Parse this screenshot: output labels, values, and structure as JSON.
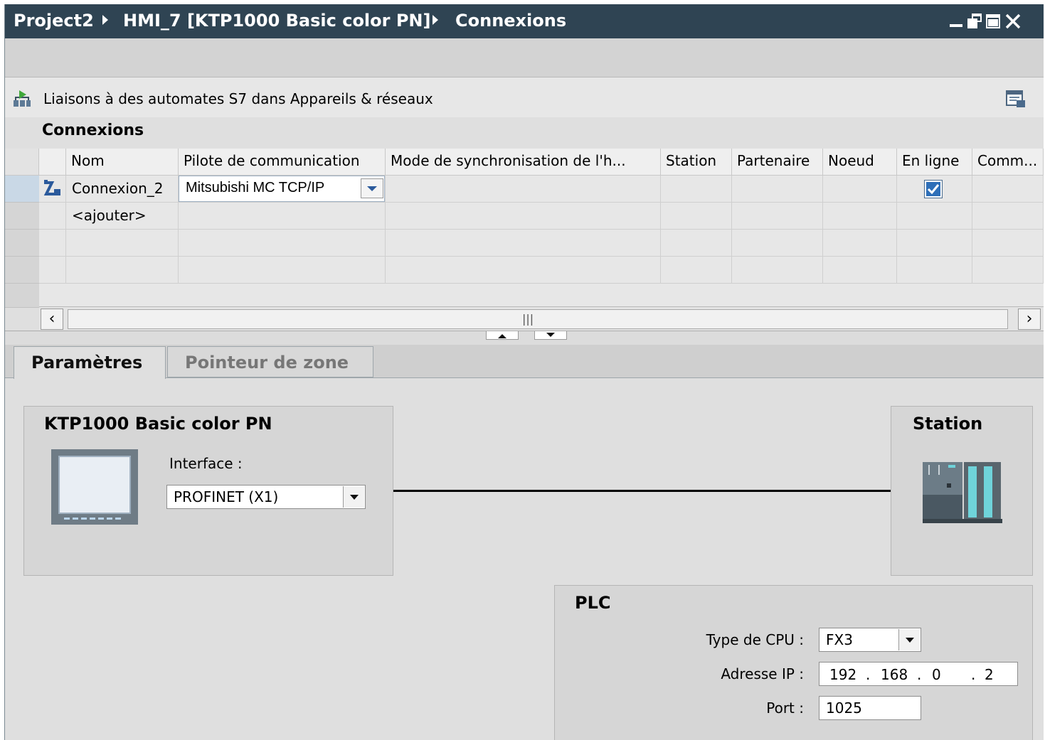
{
  "window": {
    "breadcrumb": [
      "Project2",
      "HMI_7 [KTP1000 Basic color PN]",
      "Connexions"
    ],
    "controls": [
      "minimize-icon",
      "restore-icon",
      "maximize-icon",
      "close-icon"
    ]
  },
  "info_bar": {
    "text": "Liaisons à des automates S7 dans Appareils & réseaux"
  },
  "connections": {
    "title": "Connexions",
    "columns": [
      "Nom",
      "Pilote de communication",
      "Mode de synchronisation de l'h...",
      "Station",
      "Partenaire",
      "Noeud",
      "En ligne",
      "Comm..."
    ],
    "rows": [
      {
        "name": "Connexion_2",
        "driver": "Mitsubishi MC TCP/IP",
        "sync_mode": "",
        "station": "",
        "partner": "",
        "node": "",
        "online": true,
        "comment": ""
      }
    ],
    "add_row": "<ajouter>"
  },
  "scrollbar": {
    "thumb_grip": "|||"
  },
  "tabs": [
    {
      "label": "Paramètres",
      "active": true
    },
    {
      "label": "Pointeur de zone",
      "active": false
    }
  ],
  "hmi_device": {
    "title": "KTP1000 Basic color PN",
    "interface_label": "Interface :",
    "interface_value": "PROFINET (X1)"
  },
  "station": {
    "title": "Station"
  },
  "plc": {
    "title": "PLC",
    "cpu_type_label": "Type de CPU :",
    "cpu_type_value": "FX3",
    "ip_label": "Adresse IP :",
    "ip": [
      "192",
      "168",
      "0",
      "2"
    ],
    "ip_separator": ".",
    "port_label": "Port :",
    "port_value": "1025"
  },
  "colors": {
    "titlebar": "#2f4453",
    "panel": "#dfdfdf",
    "selection": "#c9d8e6"
  }
}
